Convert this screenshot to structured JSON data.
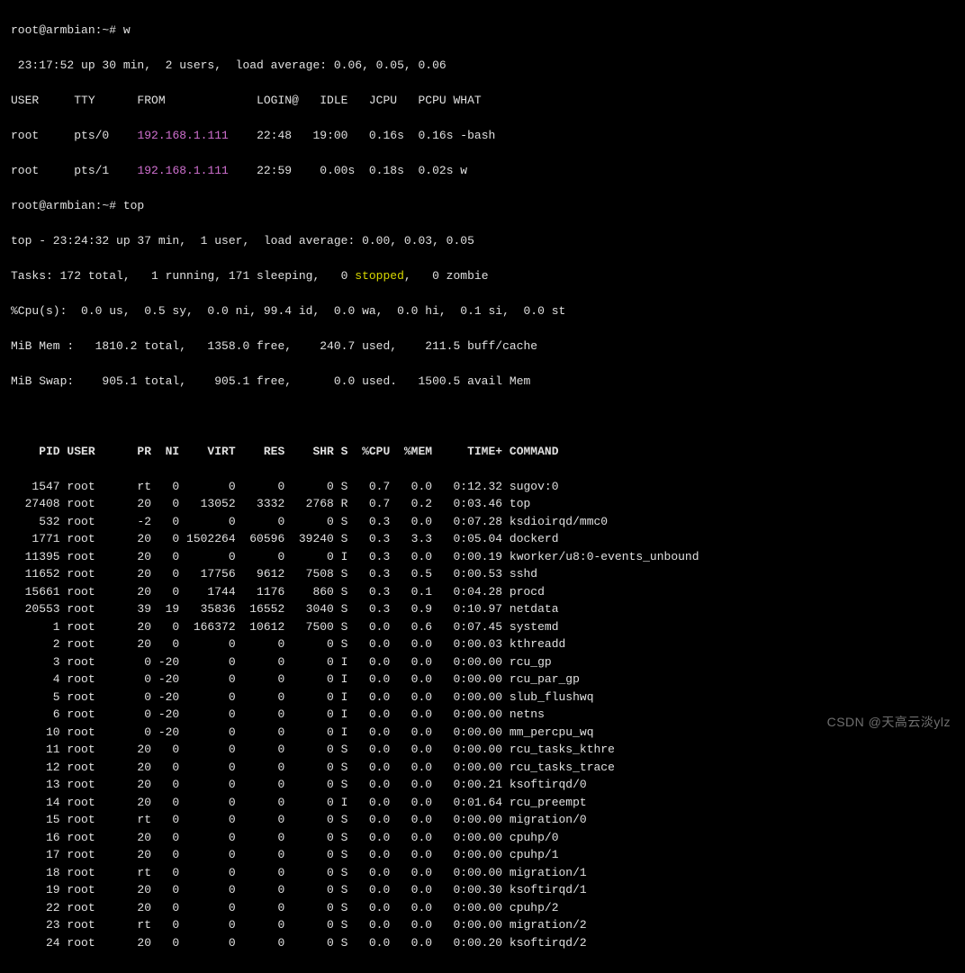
{
  "chart_data": {
    "type": "table",
    "title": "top process list",
    "columns": [
      "PID",
      "USER",
      "PR",
      "NI",
      "VIRT",
      "RES",
      "SHR",
      "S",
      "%CPU",
      "%MEM",
      "TIME+",
      "COMMAND"
    ],
    "rows": [
      [
        1547,
        "root",
        "rt",
        0,
        0,
        0,
        0,
        "S",
        0.7,
        0.0,
        "0:12.32",
        "sugov:0"
      ],
      [
        27408,
        "root",
        20,
        0,
        13052,
        3332,
        2768,
        "R",
        0.7,
        0.2,
        "0:03.46",
        "top"
      ],
      [
        532,
        "root",
        -2,
        0,
        0,
        0,
        0,
        "S",
        0.3,
        0.0,
        "0:07.28",
        "ksdioirqd/mmc0"
      ],
      [
        1771,
        "root",
        20,
        0,
        1502264,
        60596,
        39240,
        "S",
        0.3,
        3.3,
        "0:05.04",
        "dockerd"
      ],
      [
        11395,
        "root",
        20,
        0,
        0,
        0,
        0,
        "I",
        0.3,
        0.0,
        "0:00.19",
        "kworker/u8:0-events_unbound"
      ],
      [
        11652,
        "root",
        20,
        0,
        17756,
        9612,
        7508,
        "S",
        0.3,
        0.5,
        "0:00.53",
        "sshd"
      ],
      [
        15661,
        "root",
        20,
        0,
        1744,
        1176,
        860,
        "S",
        0.3,
        0.1,
        "0:04.28",
        "procd"
      ],
      [
        20553,
        "root",
        39,
        19,
        35836,
        16552,
        3040,
        "S",
        0.3,
        0.9,
        "0:10.97",
        "netdata"
      ],
      [
        1,
        "root",
        20,
        0,
        166372,
        10612,
        7500,
        "S",
        0.0,
        0.6,
        "0:07.45",
        "systemd"
      ],
      [
        2,
        "root",
        20,
        0,
        0,
        0,
        0,
        "S",
        0.0,
        0.0,
        "0:00.03",
        "kthreadd"
      ],
      [
        3,
        "root",
        0,
        -20,
        0,
        0,
        0,
        "I",
        0.0,
        0.0,
        "0:00.00",
        "rcu_gp"
      ],
      [
        4,
        "root",
        0,
        -20,
        0,
        0,
        0,
        "I",
        0.0,
        0.0,
        "0:00.00",
        "rcu_par_gp"
      ],
      [
        5,
        "root",
        0,
        -20,
        0,
        0,
        0,
        "I",
        0.0,
        0.0,
        "0:00.00",
        "slub_flushwq"
      ],
      [
        6,
        "root",
        0,
        -20,
        0,
        0,
        0,
        "I",
        0.0,
        0.0,
        "0:00.00",
        "netns"
      ],
      [
        10,
        "root",
        0,
        -20,
        0,
        0,
        0,
        "I",
        0.0,
        0.0,
        "0:00.00",
        "mm_percpu_wq"
      ],
      [
        11,
        "root",
        20,
        0,
        0,
        0,
        0,
        "S",
        0.0,
        0.0,
        "0:00.00",
        "rcu_tasks_kthre"
      ],
      [
        12,
        "root",
        20,
        0,
        0,
        0,
        0,
        "S",
        0.0,
        0.0,
        "0:00.00",
        "rcu_tasks_trace"
      ],
      [
        13,
        "root",
        20,
        0,
        0,
        0,
        0,
        "S",
        0.0,
        0.0,
        "0:00.21",
        "ksoftirqd/0"
      ],
      [
        14,
        "root",
        20,
        0,
        0,
        0,
        0,
        "I",
        0.0,
        0.0,
        "0:01.64",
        "rcu_preempt"
      ],
      [
        15,
        "root",
        "rt",
        0,
        0,
        0,
        0,
        "S",
        0.0,
        0.0,
        "0:00.00",
        "migration/0"
      ],
      [
        16,
        "root",
        20,
        0,
        0,
        0,
        0,
        "S",
        0.0,
        0.0,
        "0:00.00",
        "cpuhp/0"
      ],
      [
        17,
        "root",
        20,
        0,
        0,
        0,
        0,
        "S",
        0.0,
        0.0,
        "0:00.00",
        "cpuhp/1"
      ],
      [
        18,
        "root",
        "rt",
        0,
        0,
        0,
        0,
        "S",
        0.0,
        0.0,
        "0:00.00",
        "migration/1"
      ],
      [
        19,
        "root",
        20,
        0,
        0,
        0,
        0,
        "S",
        0.0,
        0.0,
        "0:00.30",
        "ksoftirqd/1"
      ],
      [
        22,
        "root",
        20,
        0,
        0,
        0,
        0,
        "S",
        0.0,
        0.0,
        "0:00.00",
        "cpuhp/2"
      ],
      [
        23,
        "root",
        "rt",
        0,
        0,
        0,
        0,
        "S",
        0.0,
        0.0,
        "0:00.00",
        "migration/2"
      ],
      [
        24,
        "root",
        20,
        0,
        0,
        0,
        0,
        "S",
        0.0,
        0.0,
        "0:00.20",
        "ksoftirqd/2"
      ]
    ]
  },
  "prompt1": "root@armbian:~# ",
  "cmd1": "w",
  "w_line1": " 23:17:52 up 30 min,  2 users,  load average: 0.06, 0.05, 0.06",
  "w_header": "USER     TTY      FROM             LOGIN@   IDLE   JCPU   PCPU WHAT",
  "w_row1_a": "root     pts/0    ",
  "w_row1_ip": "192.168.1.111",
  "w_row1_b": "    22:48   19:00   0.16s  0.16s -bash",
  "w_row2_a": "root     pts/1    ",
  "w_row2_ip": "192.168.1.111",
  "w_row2_b": "    22:59    0.00s  0.18s  0.02s w",
  "prompt2": "root@armbian:~# ",
  "cmd2": "top",
  "top_line1": "top - 23:24:32 up 37 min,  1 user,  load average: 0.00, 0.03, 0.05",
  "top_tasks_a": "Tasks: 172 total,   1 running, 171 sleeping,   0 ",
  "top_tasks_stopped": "stopped",
  "top_tasks_b": ",   0 zombie",
  "top_cpu": "%Cpu(s):  0.0 us,  0.5 sy,  0.0 ni, 99.4 id,  0.0 wa,  0.0 hi,  0.1 si,  0.0 st",
  "top_mem": "MiB Mem :   1810.2 total,   1358.0 free,    240.7 used,    211.5 buff/cache",
  "top_swap": "MiB Swap:    905.1 total,    905.1 free,      0.0 used.   1500.5 avail Mem",
  "top_header": "    PID USER      PR  NI    VIRT    RES    SHR S  %CPU  %MEM     TIME+ COMMAND",
  "watermark": "CSDN @天高云淡ylz"
}
